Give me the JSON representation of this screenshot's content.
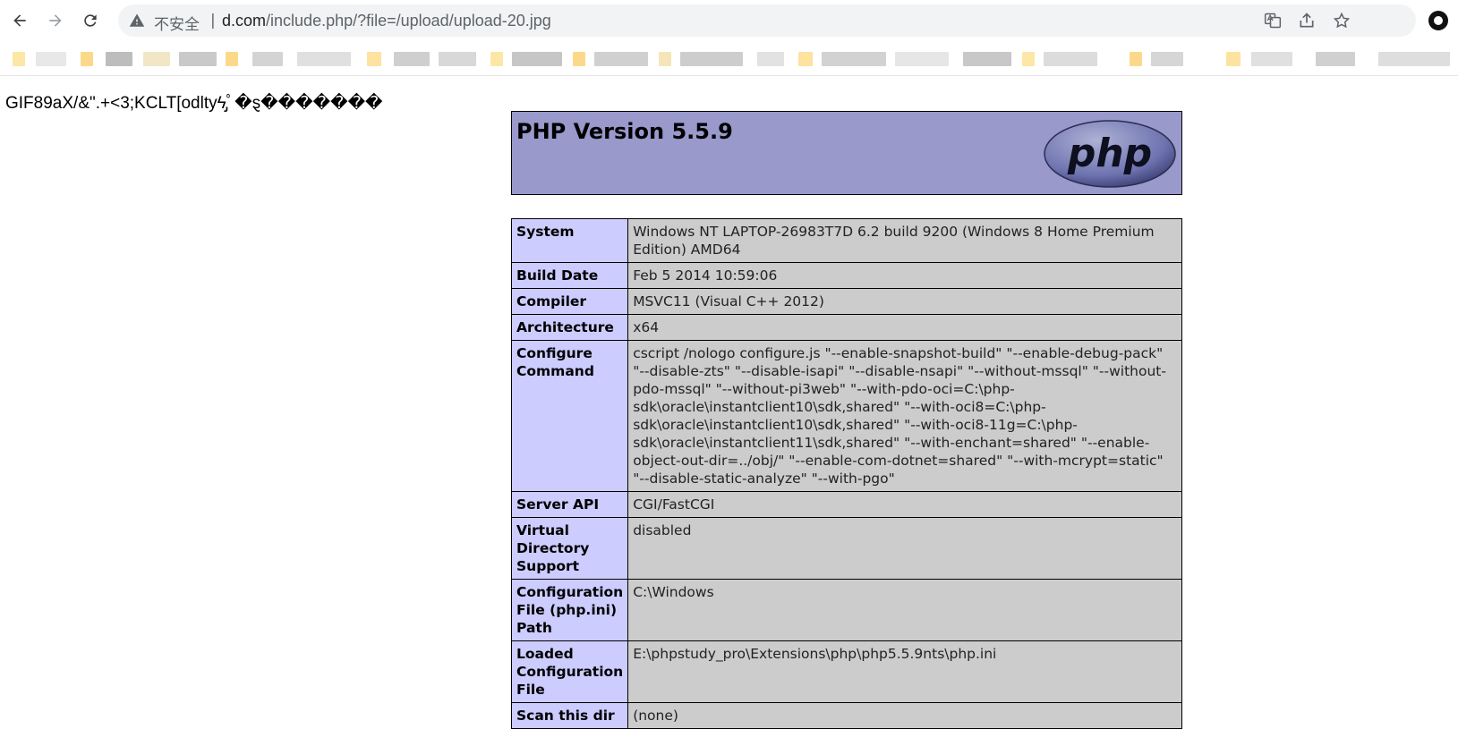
{
  "browser": {
    "security_label": "不安全",
    "separator": "|",
    "url_host": "d.com",
    "url_path": "/include.php/?file=/upload/upload-20.jpg",
    "icons": [
      "back-icon",
      "forward-icon",
      "reload-icon",
      "warning-icon",
      "translate-icon",
      "share-icon",
      "star-icon",
      "profile-icon"
    ]
  },
  "page": {
    "gif_header": "GIF89aX/&\".+<3;KCLT[odltyϟ̡ﾟ�ȿ�������"
  },
  "phpinfo": {
    "title": "PHP Version 5.5.9",
    "logo_text": "php",
    "rows": [
      {
        "label": "System",
        "value": "Windows NT LAPTOP-26983T7D 6.2 build 9200 (Windows 8 Home Premium Edition) AMD64"
      },
      {
        "label": "Build Date",
        "value": "Feb 5 2014 10:59:06"
      },
      {
        "label": "Compiler",
        "value": "MSVC11 (Visual C++ 2012)"
      },
      {
        "label": "Architecture",
        "value": "x64"
      },
      {
        "label": "Configure Command",
        "value": "cscript /nologo configure.js \"--enable-snapshot-build\" \"--enable-debug-pack\" \"--disable-zts\" \"--disable-isapi\" \"--disable-nsapi\" \"--without-mssql\" \"--without-pdo-mssql\" \"--without-pi3web\" \"--with-pdo-oci=C:\\php-sdk\\oracle\\instantclient10\\sdk,shared\" \"--with-oci8=C:\\php-sdk\\oracle\\instantclient10\\sdk,shared\" \"--with-oci8-11g=C:\\php-sdk\\oracle\\instantclient11\\sdk,shared\" \"--with-enchant=shared\" \"--enable-object-out-dir=../obj/\" \"--enable-com-dotnet=shared\" \"--with-mcrypt=static\" \"--disable-static-analyze\" \"--with-pgo\""
      },
      {
        "label": "Server API",
        "value": "CGI/FastCGI"
      },
      {
        "label": "Virtual Directory Support",
        "value": "disabled"
      },
      {
        "label": "Configuration File (php.ini) Path",
        "value": "C:\\Windows"
      },
      {
        "label": "Loaded Configuration File",
        "value": "E:\\phpstudy_pro\\Extensions\\php\\php5.5.9nts\\php.ini"
      },
      {
        "label": "Scan this dir",
        "value": "(none)"
      }
    ]
  },
  "colors": {
    "header_bg": "#9999cc",
    "label_bg": "#ccccff",
    "value_bg": "#cccccc",
    "omnibox_bg": "#f1f3f4"
  }
}
